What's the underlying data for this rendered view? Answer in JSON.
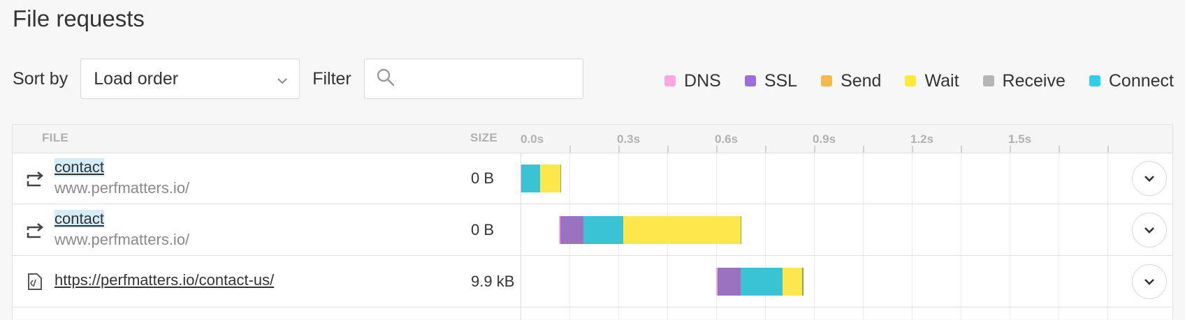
{
  "page": {
    "title": "File requests"
  },
  "controls": {
    "sort_label": "Sort by",
    "sort_value": "Load order",
    "filter_label": "Filter",
    "filter_value": "",
    "filter_placeholder": ""
  },
  "legend": [
    {
      "label": "DNS",
      "color": "#f9a8e0"
    },
    {
      "label": "SSL",
      "color": "#9b6fe0"
    },
    {
      "label": "Send",
      "color": "#f6b94a"
    },
    {
      "label": "Wait",
      "color": "#ffe83a"
    },
    {
      "label": "Receive",
      "color": "#b5b5b5"
    },
    {
      "label": "Connect",
      "color": "#2bd0ea"
    }
  ],
  "table": {
    "columns": {
      "file": "FILE",
      "size": "SIZE"
    },
    "ticks": [
      {
        "t": 0.0,
        "label": "0.0s"
      },
      {
        "t": 0.3,
        "label": "0.3s"
      },
      {
        "t": 0.6,
        "label": "0.6s"
      },
      {
        "t": 0.9,
        "label": "0.9s"
      },
      {
        "t": 1.2,
        "label": "1.2s"
      },
      {
        "t": 1.5,
        "label": "1.5s"
      }
    ],
    "timeline_max_s": 1.8,
    "rows": [
      {
        "icon": "redirect-icon",
        "name": "contact",
        "host": "www.perfmatters.io/",
        "size": "0 B",
        "highlighted": true,
        "segments": [
          {
            "phase": "DNS",
            "color": "#f9a8e0",
            "start": 0.0,
            "duration": 0.003
          },
          {
            "phase": "Connect",
            "color": "#39c3d3",
            "start": 0.003,
            "duration": 0.057
          },
          {
            "phase": "Wait",
            "color": "#fde74c",
            "start": 0.06,
            "duration": 0.062
          },
          {
            "phase": "Receive",
            "color": "#7fb14b",
            "start": 0.122,
            "duration": 0.003
          }
        ]
      },
      {
        "icon": "redirect-icon",
        "name": "contact",
        "host": "www.perfmatters.io/",
        "size": "0 B",
        "highlighted": true,
        "segments": [
          {
            "phase": "DNS",
            "color": "#f9a8e0",
            "start": 0.118,
            "duration": 0.004
          },
          {
            "phase": "SSL",
            "color": "#9a72bf",
            "start": 0.122,
            "duration": 0.07
          },
          {
            "phase": "Connect",
            "color": "#39c3d3",
            "start": 0.192,
            "duration": 0.124
          },
          {
            "phase": "Wait",
            "color": "#fde74c",
            "start": 0.316,
            "duration": 0.358
          },
          {
            "phase": "Receive",
            "color": "#7fb14b",
            "start": 0.674,
            "duration": 0.003
          }
        ]
      },
      {
        "icon": "document-icon",
        "name": "https://perfmatters.io/contact-us/",
        "host": "",
        "size": "9.9 kB",
        "highlighted": false,
        "segments": [
          {
            "phase": "DNS",
            "color": "#f9a8e0",
            "start": 0.6,
            "duration": 0.004
          },
          {
            "phase": "SSL",
            "color": "#9a72bf",
            "start": 0.604,
            "duration": 0.07
          },
          {
            "phase": "Connect",
            "color": "#39c3d3",
            "start": 0.674,
            "duration": 0.13
          },
          {
            "phase": "Wait",
            "color": "#fde74c",
            "start": 0.804,
            "duration": 0.06
          },
          {
            "phase": "Receive",
            "color": "#7fb14b",
            "start": 0.864,
            "duration": 0.003
          }
        ]
      }
    ]
  }
}
